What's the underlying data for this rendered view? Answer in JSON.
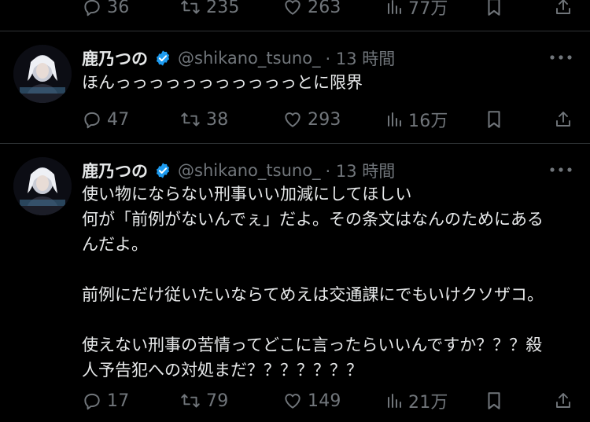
{
  "top_actions": {
    "replies": "36",
    "reposts": "235",
    "likes": "263",
    "views": "77万"
  },
  "tweets": [
    {
      "name": "鹿乃つの",
      "handle": "@shikano_tsuno_",
      "time": "· 13 時間",
      "lines": [
        "ほんっっっっっっっっっっっとに限界"
      ],
      "actions": {
        "replies": "47",
        "reposts": "38",
        "likes": "293",
        "views": "16万"
      }
    },
    {
      "name": "鹿乃つの",
      "handle": "@shikano_tsuno_",
      "time": "· 13 時間",
      "lines": [
        "使い物にならない刑事いい加減にしてほしい",
        "何が「前例がないんでぇ」だよ。その条文はなんのためにある",
        "んだよ。",
        "",
        "前例にだけ従いたいならてめえは交通課にでもいけクソザコ。",
        "",
        "使えない刑事の苦情ってどこに言ったらいいんですか？？？殺",
        "人予告犯への対処まだ？？？？？？？"
      ],
      "actions": {
        "replies": "17",
        "reposts": "79",
        "likes": "149",
        "views": "21万"
      }
    }
  ],
  "colors": {
    "background": "#000000",
    "text": "#e7e9ea",
    "muted": "#71767b",
    "verified": "#1d9bf0",
    "divider": "#2f3336"
  }
}
